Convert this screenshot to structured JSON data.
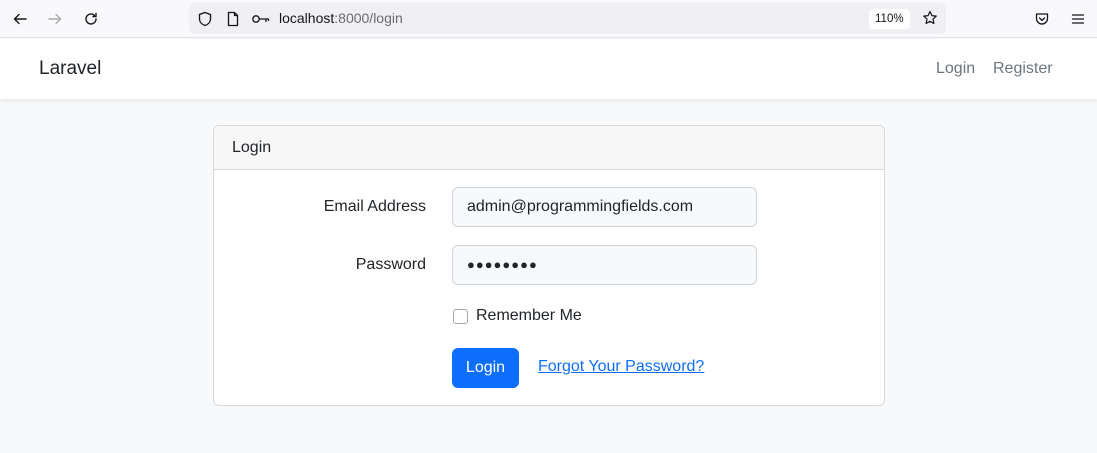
{
  "browser": {
    "url_host": "localhost",
    "url_rest": ":8000/login",
    "zoom": "110%",
    "icons": [
      "back-arrow-icon",
      "forward-arrow-icon",
      "reload-icon",
      "shield-icon",
      "page-icon",
      "key-icon",
      "star-icon",
      "pocket-icon",
      "menu-icon"
    ]
  },
  "navbar": {
    "brand": "Laravel",
    "links": [
      "Login",
      "Register"
    ]
  },
  "card": {
    "title": "Login",
    "email_label": "Email Address",
    "email_value": "admin@programmingfields.com",
    "password_label": "Password",
    "password_mask": "●●●●●●●●",
    "remember_label": "Remember Me",
    "submit_label": "Login",
    "forgot_label": "Forgot Your Password?"
  },
  "colors": {
    "primary": "#0d6efd",
    "page_bg": "#f8f9fa"
  }
}
